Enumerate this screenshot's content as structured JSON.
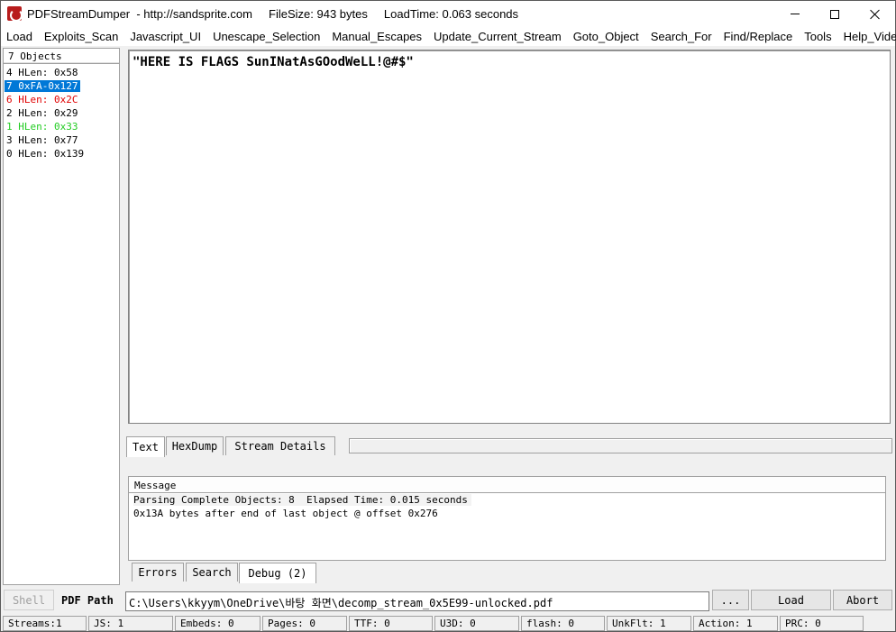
{
  "window": {
    "title": "PDFStreamDumper  - http://sandsprite.com     FileSize: 943 bytes     LoadTime: 0.063 seconds"
  },
  "menu": [
    "Load",
    "Exploits_Scan",
    "Javascript_UI",
    "Unescape_Selection",
    "Manual_Escapes",
    "Update_Current_Stream",
    "Goto_Object",
    "Search_For",
    "Find/Replace",
    "Tools",
    "Help_Videos"
  ],
  "objects": {
    "header": "7 Objects",
    "items": [
      {
        "label": "4 HLen: 0x58",
        "color": "#000000",
        "selected": false
      },
      {
        "label": "7 0xFA-0x127",
        "color": "#ffffff",
        "selected": true
      },
      {
        "label": "6 HLen: 0x2C",
        "color": "#e00000",
        "selected": false
      },
      {
        "label": "2 HLen: 0x29",
        "color": "#000000",
        "selected": false
      },
      {
        "label": "1 HLen: 0x33",
        "color": "#22cc22",
        "selected": false
      },
      {
        "label": "3 HLen: 0x77",
        "color": "#000000",
        "selected": false
      },
      {
        "label": "0 HLen: 0x139",
        "color": "#000000",
        "selected": false
      }
    ]
  },
  "editor": {
    "content": "\"HERE IS FLAGS SunINatAsGOodWeLL!@#$\""
  },
  "view_tabs": [
    "Text",
    "HexDump",
    "Stream Details"
  ],
  "message": {
    "header": "Message",
    "lines": [
      "Parsing Complete Objects: 8  Elapsed Time: 0.015 seconds",
      "0x13A bytes after end of last object @ offset 0x276"
    ]
  },
  "msg_tabs": [
    "Errors",
    "Search",
    "Debug (2)"
  ],
  "bottom": {
    "shell_label": "Shell",
    "path_label": "PDF Path",
    "path_value": "C:\\Users\\kkyym\\OneDrive\\바탕 화면\\decomp_stream_0x5E99-unlocked.pdf",
    "browse_label": "...",
    "load_label": "Load",
    "abort_label": "Abort"
  },
  "status": [
    "Streams:1",
    "JS: 1",
    "Embeds: 0",
    "Pages: 0",
    "TTF: 0",
    "U3D: 0",
    "flash: 0",
    "UnkFlt: 1",
    "Action: 1",
    "PRC: 0"
  ]
}
